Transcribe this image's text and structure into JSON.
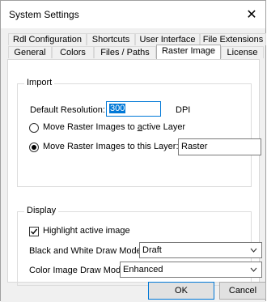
{
  "window": {
    "title": "System Settings"
  },
  "tabs": {
    "row1": [
      {
        "label": "Rdl Configuration"
      },
      {
        "label": "Shortcuts"
      },
      {
        "label": "User Interface"
      },
      {
        "label": "File Extensions"
      }
    ],
    "row2": [
      {
        "label": "General"
      },
      {
        "label": "Colors"
      },
      {
        "label": "Files / Paths"
      },
      {
        "label": "Raster Image",
        "active": true
      },
      {
        "label": "License"
      }
    ]
  },
  "import": {
    "legend": "Import",
    "resolution_label": "Default Resolution:",
    "resolution_value": "300",
    "resolution_unit": "DPI",
    "radio_active_label_pre": "Move Raster Images to ",
    "radio_active_label_key": "a",
    "radio_active_label_post": "ctive Layer",
    "radio_this_label": "Move Raster Images to this Layer:",
    "layer_value": "Raster",
    "selected_option": "this_layer"
  },
  "display": {
    "legend": "Display",
    "highlight_label": "Highlight active image",
    "highlight_checked": true,
    "bw_label": "Black and White Draw Mode",
    "bw_value": "Draft",
    "color_label": "Color Image Draw Mode",
    "color_value": "Enhanced"
  },
  "buttons": {
    "ok": "OK",
    "cancel": "Cancel"
  }
}
